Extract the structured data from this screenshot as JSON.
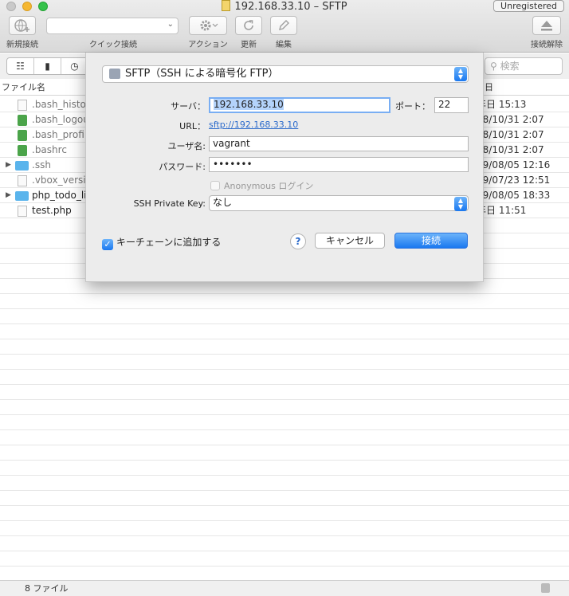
{
  "window": {
    "title": "192.168.33.10 – SFTP",
    "unregistered": "Unregistered"
  },
  "toolbar": {
    "new_connection": "新規接続",
    "quick_connect": "クイック接続",
    "action": "アクション",
    "refresh": "更新",
    "edit": "編集",
    "disconnect": "接続解除"
  },
  "search": {
    "placeholder": "検索"
  },
  "columns": {
    "filename": "ファイル名",
    "date": "日"
  },
  "files": [
    {
      "name": ".bash_histor",
      "date": "年日 15:13",
      "icon": "doc-icon",
      "expand": false,
      "dark": false
    },
    {
      "name": ".bash_logou",
      "date": "18/10/31 2:07",
      "icon": "shell-script-icon",
      "expand": false,
      "dark": false
    },
    {
      "name": ".bash_profile",
      "date": "18/10/31 2:07",
      "icon": "shell-script-icon",
      "expand": false,
      "dark": false
    },
    {
      "name": ".bashrc",
      "date": "18/10/31 2:07",
      "icon": "shell-script-icon",
      "expand": false,
      "dark": false
    },
    {
      "name": ".ssh",
      "date": "19/08/05 12:16",
      "icon": "folder-icon",
      "expand": true,
      "dark": false
    },
    {
      "name": ".vbox_versio",
      "date": "19/07/23 12:51",
      "icon": "doc-icon",
      "expand": false,
      "dark": false
    },
    {
      "name": "php_todo_lis",
      "date": "19/08/05 18:33",
      "icon": "folder-icon",
      "expand": true,
      "dark": true
    },
    {
      "name": "test.php",
      "date": "年日 11:51",
      "icon": "doc-icon",
      "expand": false,
      "dark": true
    }
  ],
  "status": {
    "count": "8 ファイル"
  },
  "dialog": {
    "protocol": "SFTP（SSH による暗号化 FTP）",
    "server_label": "サーバ：",
    "server_value": "192.168.33.10",
    "port_label": "ポート：",
    "port_value": "22",
    "url_label": "URL：",
    "url_value": "sftp://192.168.33.10",
    "username_label": "ユーザ名:",
    "username_value": "vagrant",
    "password_label": "パスワード:",
    "password_value": "•••••••",
    "anonymous_label": "Anonymous ログイン",
    "private_key_label": "SSH Private Key:",
    "private_key_value": "なし",
    "keychain_label": "キーチェーンに追加する",
    "help": "?",
    "cancel": "キャンセル",
    "connect": "接続"
  }
}
